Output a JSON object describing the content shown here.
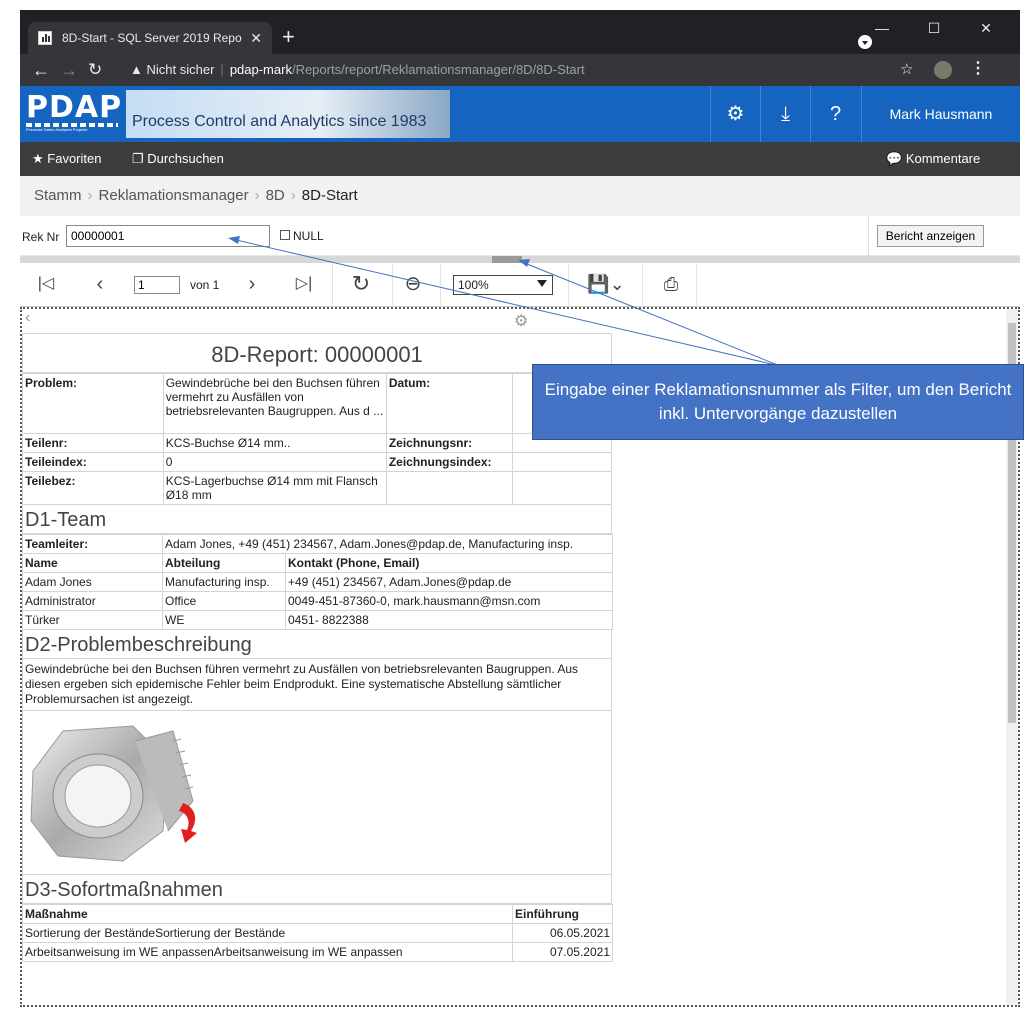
{
  "browser": {
    "tab_title": "8D-Start - SQL Server 2019 Repo",
    "new_tab": "+",
    "url_warning": "Nicht sicher",
    "url_host": "pdap-mark",
    "url_path": "/Reports/report/Reklamationsmanager/8D/8D-Start"
  },
  "header": {
    "logo": "PDAP",
    "logo_small": "Prozesse Daten Analysen Projekte",
    "slogan": "Process Control and Analytics since 1983",
    "user": "Mark Hausmann"
  },
  "toolbar": {
    "favorites": "Favoriten",
    "browse": "Durchsuchen",
    "comments": "Kommentare"
  },
  "breadcrumb": [
    "Stamm",
    "Reklamationsmanager",
    "8D",
    "8D-Start"
  ],
  "params": {
    "rek_label": "Rek Nr",
    "rek_value": "00000001",
    "null_label": "NULL",
    "show_button": "Bericht anzeigen"
  },
  "report_toolbar": {
    "page": "1",
    "of": "von 1",
    "zoom": "100%"
  },
  "report": {
    "title": "8D-Report: 00000001",
    "header_rows": [
      {
        "l1": "Problem:",
        "v1": "Gewindebrüche bei den Buchsen führen vermehrt zu Ausfällen von betriebsrelevanten Baugruppen. Aus d ...",
        "l2": "Datum:",
        "v2": ""
      },
      {
        "l1": "Teilenr:",
        "v1": "KCS-Buchse Ø14 mm..",
        "l2": "Zeichnungsnr:",
        "v2": ""
      },
      {
        "l1": "Teileindex:",
        "v1": "0",
        "l2": "Zeichnungsindex:",
        "v2": ""
      },
      {
        "l1": "Teilebez:",
        "v1": "KCS-Lagerbuchse Ø14 mm mit Flansch Ø18 mm",
        "l2": "",
        "v2": ""
      }
    ],
    "d1": {
      "title": "D1-Team",
      "lead_label": "Teamleiter:",
      "lead_value": "Adam Jones, +49 (451) 234567, Adam.Jones@pdap.de, Manufacturing insp.",
      "cols": [
        "Name",
        "Abteilung",
        "Kontakt (Phone, Email)"
      ],
      "rows": [
        [
          "Adam Jones",
          "Manufacturing insp.",
          "+49 (451) 234567, Adam.Jones@pdap.de"
        ],
        [
          "Administrator",
          "Office",
          "0049-451-87360-0, mark.hausmann@msn.com"
        ],
        [
          "Türker",
          "WE",
          "0451- 8822388"
        ]
      ]
    },
    "d2": {
      "title": "D2-Problembeschreibung",
      "text": "Gewindebrüche bei den Buchsen führen vermehrt zu Ausfällen von betriebsrelevanten Baugruppen. Aus diesen ergeben sich epidemische Fehler beim Endprodukt. Eine systematische Abstellung sämtlicher Problemursachen ist angezeigt."
    },
    "d3": {
      "title": "D3-Sofortmaßnahmen",
      "cols": [
        "Maßnahme",
        "Einführung"
      ],
      "rows": [
        [
          "Sortierung der BeständeSortierung der Bestände",
          "06.05.2021"
        ],
        [
          "Arbeitsanweisung im WE anpassenArbeitsanweisung im WE anpassen",
          "07.05.2021"
        ]
      ]
    }
  },
  "callout": "Eingabe einer Reklamationsnummer als Filter, um den Bericht inkl. Untervorgänge dazustellen",
  "colors": {
    "app_blue": "#1565c0",
    "toolbar_dark": "#3d3d3d",
    "callout": "#4472c4"
  },
  "icons": [
    "gear-icon",
    "download-icon",
    "help-icon",
    "star-icon",
    "browse-icon",
    "comment-icon",
    "first-page-icon",
    "prev-page-icon",
    "next-page-icon",
    "last-page-icon",
    "refresh-icon",
    "back-icon",
    "save-icon",
    "print-icon"
  ]
}
